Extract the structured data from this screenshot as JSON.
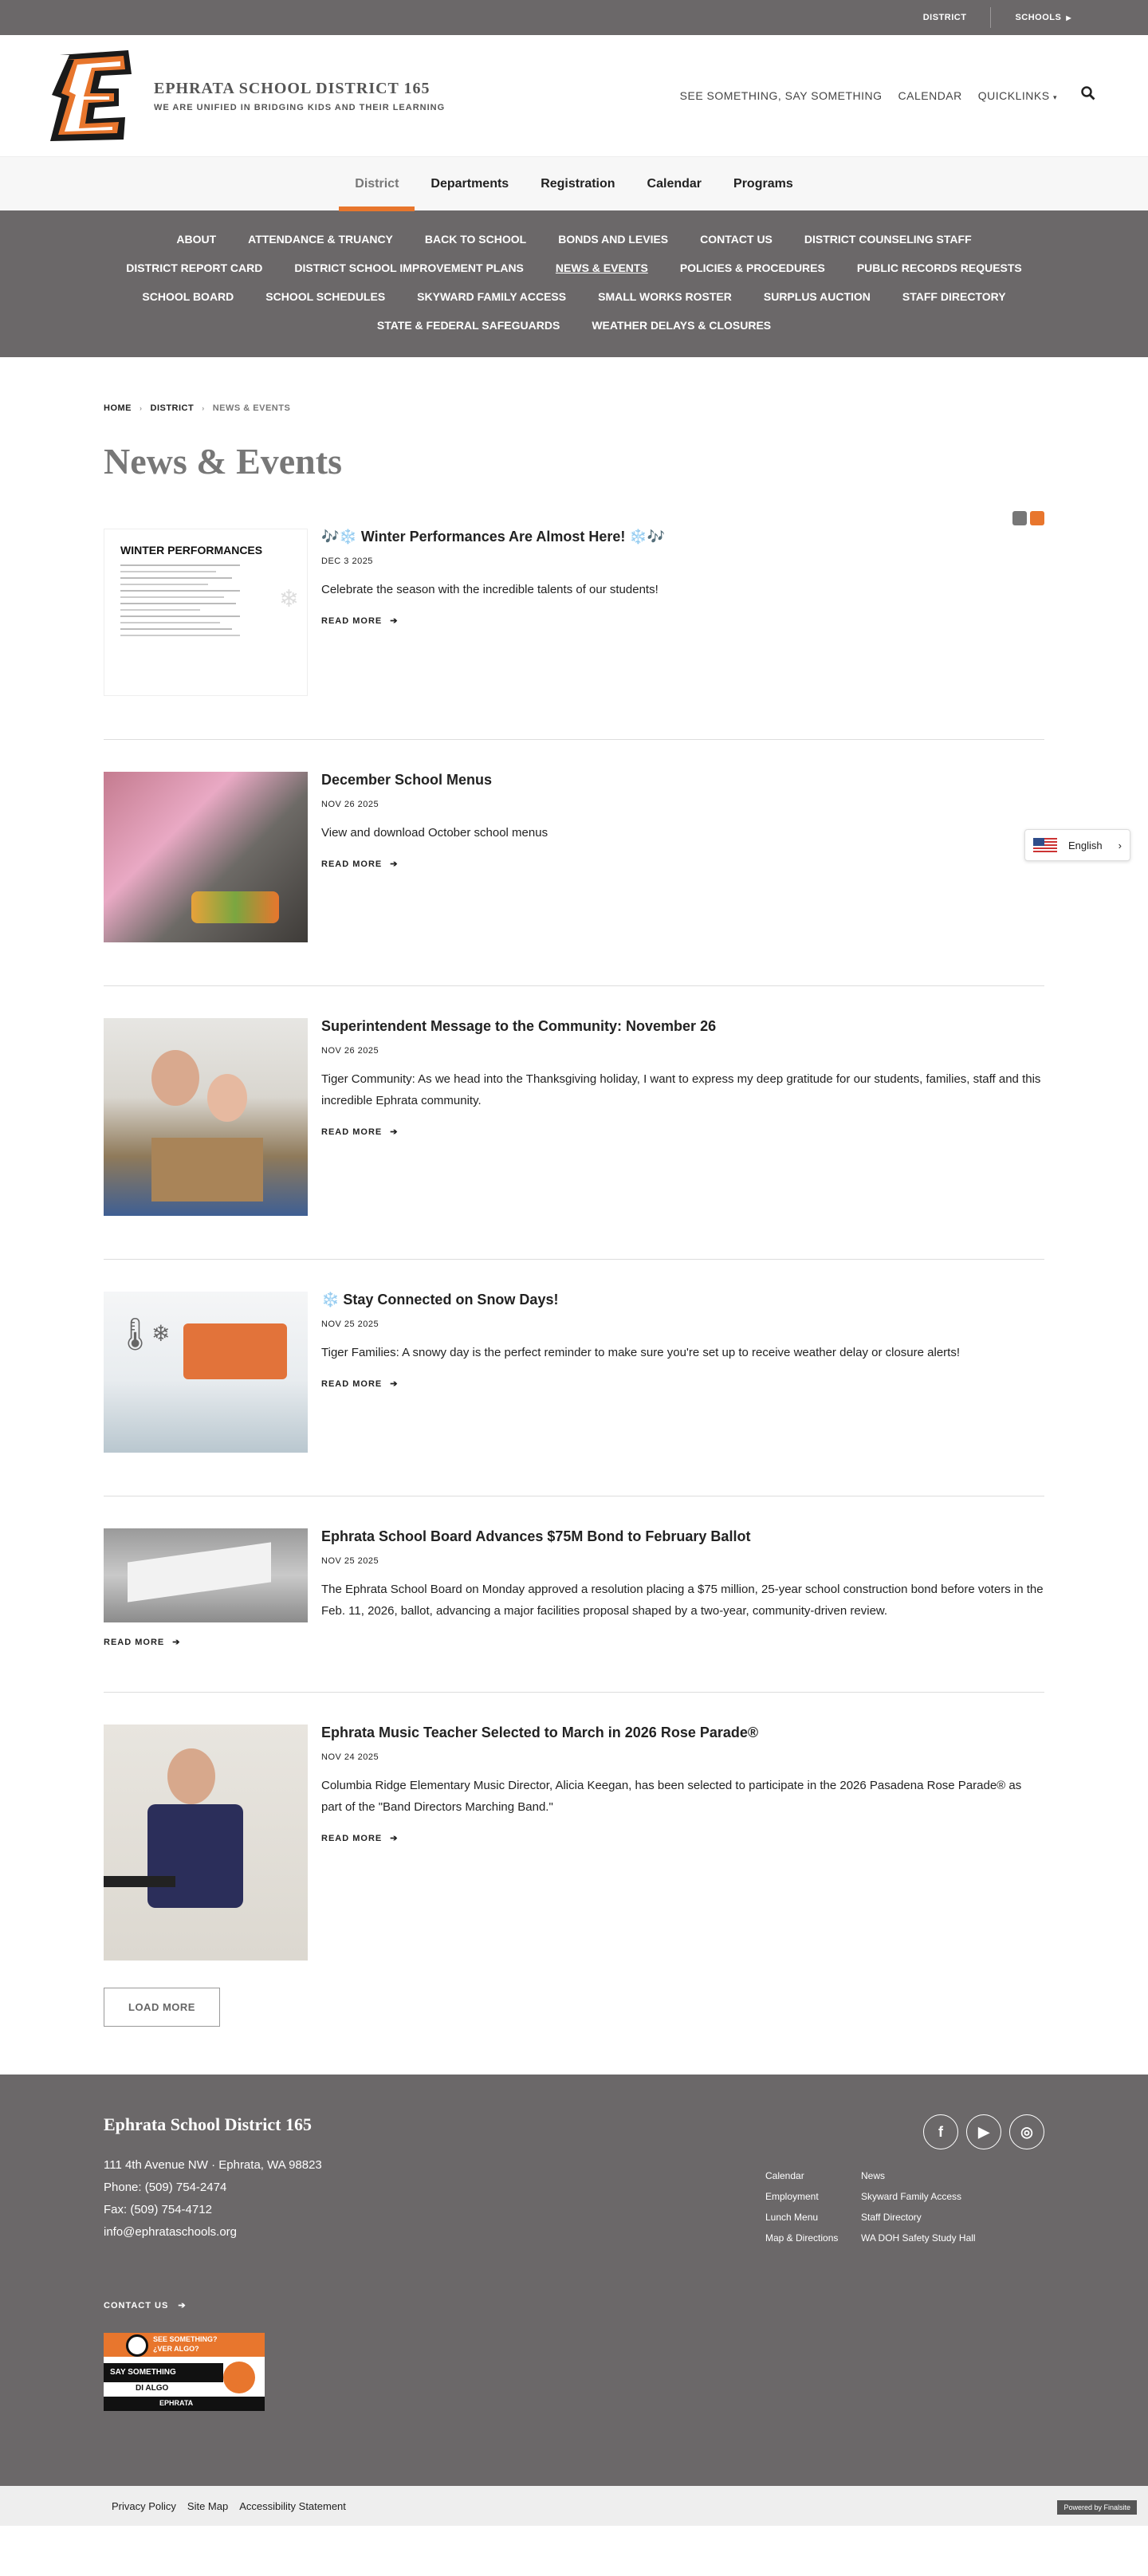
{
  "utility": {
    "district": "DISTRICT",
    "schools": "SCHOOLS"
  },
  "header": {
    "name": "EPHRATA SCHOOL DISTRICT 165",
    "tagline": "WE ARE UNIFIED IN BRIDGING KIDS AND THEIR LEARNING",
    "links": [
      "SEE SOMETHING, SAY SOMETHING",
      "CALENDAR",
      "QUICKLINKS"
    ]
  },
  "mainnav": [
    "District",
    "Departments",
    "Registration",
    "Calendar",
    "Programs"
  ],
  "subnav": [
    [
      "ABOUT",
      "ATTENDANCE & TRUANCY",
      "BACK TO SCHOOL",
      "BONDS AND LEVIES",
      "CONTACT US",
      "DISTRICT COUNSELING STAFF"
    ],
    [
      "DISTRICT REPORT CARD",
      "DISTRICT SCHOOL IMPROVEMENT PLANS",
      "NEWS & EVENTS",
      "POLICIES & PROCEDURES",
      "PUBLIC RECORDS REQUESTS"
    ],
    [
      "SCHOOL BOARD",
      "SCHOOL SCHEDULES",
      "SKYWARD FAMILY ACCESS",
      "SMALL WORKS ROSTER",
      "SURPLUS AUCTION",
      "STAFF DIRECTORY"
    ],
    [
      "STATE & FEDERAL SAFEGUARDS",
      "WEATHER DELAYS & CLOSURES"
    ]
  ],
  "breadcrumb": {
    "home": "HOME",
    "district": "DISTRICT",
    "current": "NEWS & EVENTS"
  },
  "page_title": "News & Events",
  "read_more": "READ MORE",
  "posts": [
    {
      "title": "🎶❄️ Winter Performances Are Almost Here! ❄️🎶",
      "date": "DEC 3 2025",
      "summary": "Celebrate the season with the incredible talents of our students!"
    },
    {
      "title": "December School Menus",
      "date": "NOV 26 2025",
      "summary": "View and download October school menus"
    },
    {
      "title": "Superintendent Message to the Community: November 26",
      "date": "NOV 26 2025",
      "summary": "Tiger Community: As we head into the Thanksgiving holiday, I want to express my deep gratitude for our students, families, staff and this incredible Ephrata community."
    },
    {
      "title": "❄️ Stay Connected on Snow Days!",
      "date": "NOV 25 2025",
      "summary": "Tiger Families: A snowy day is the perfect reminder to make sure you're set up to receive weather delay or closure alerts!"
    },
    {
      "title": "Ephrata School Board Advances $75M Bond to February Ballot",
      "date": "NOV 25 2025",
      "summary": "The Ephrata School Board on Monday approved a resolution placing a $75 million, 25-year school construction bond before voters in the Feb. 11, 2026, ballot, advancing a major facilities proposal shaped by a two-year, community-driven review."
    },
    {
      "title": "Ephrata Music Teacher Selected to March in 2026 Rose Parade®",
      "date": "NOV 24 2025",
      "summary": "Columbia Ridge Elementary Music Director, Alicia Keegan, has been selected to participate in the 2026 Pasadena Rose Parade® as part of the \"Band Directors Marching Band.\""
    }
  ],
  "thumb_text": {
    "winter": "WINTER PERFORMANCES"
  },
  "load_more": "LOAD MORE",
  "translate": {
    "language": "English"
  },
  "footer": {
    "name": "Ephrata School District 165",
    "address": "111 4th Avenue NW · Ephrata, WA  98823",
    "phone_label": "Phone:",
    "phone": "(509) 754-2474",
    "fax": "Fax: (509) 754-4712",
    "email": "info@ephrataschools.org",
    "links": [
      "Calendar",
      "News",
      "Employment",
      "Skyward Family Access",
      "Lunch Menu",
      "Staff Directory",
      "Map & Directions",
      "WA DOH Safety Study Hall"
    ],
    "contact_us": "CONTACT US",
    "badge": {
      "line1": "SEE SOMETHING?",
      "line2": "¿VER ALGO?",
      "line3": "SAY SOMETHING",
      "line4": "DI ALGO",
      "line5": "EPHRATA"
    }
  },
  "subfooter": {
    "links": [
      "Privacy Policy",
      "Site Map",
      "Accessibility Statement"
    ],
    "powered": "Powered by Finalsite"
  },
  "colors": {
    "accent": "#e8762d",
    "gray": "#6b6869"
  }
}
